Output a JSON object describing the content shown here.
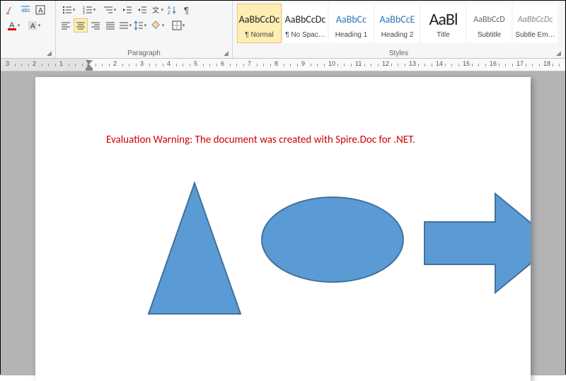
{
  "ribbon": {
    "font_group_label": "",
    "paragraph_group_label": "Paragraph",
    "styles_group_label": "Styles"
  },
  "styles": [
    {
      "preview": "AaBbCcDc",
      "name": "¶ Normal",
      "css": "sp-normal",
      "selected": true
    },
    {
      "preview": "AaBbCcDc",
      "name": "¶ No Spac…",
      "css": "sp-normal",
      "selected": false
    },
    {
      "preview": "AaBbCc",
      "name": "Heading 1",
      "css": "sp-heading",
      "selected": false
    },
    {
      "preview": "AaBbCcE",
      "name": "Heading 2",
      "css": "sp-heading",
      "selected": false
    },
    {
      "preview": "AaBl",
      "name": "Title",
      "css": "sp-title",
      "selected": false
    },
    {
      "preview": "AaBbCcD",
      "name": "Subtitle",
      "css": "sp-subtitle",
      "selected": false
    },
    {
      "preview": "AaBbCcDc",
      "name": "Subtle Em…",
      "css": "sp-subtle",
      "selected": false
    }
  ],
  "ruler": {
    "margin_left_end": 124,
    "numbers": [
      "3",
      "2",
      "1",
      "1",
      "2",
      "3",
      "4",
      "5",
      "6",
      "7",
      "8",
      "9",
      "10",
      "11",
      "12",
      "13",
      "14",
      "15",
      "16",
      "17",
      "18"
    ]
  },
  "document": {
    "warning_text": "Evaluation Warning: The document was created with Spire.Doc for .NET.",
    "shapes": {
      "fill": "#5b9bd5",
      "stroke": "#41719c"
    }
  }
}
